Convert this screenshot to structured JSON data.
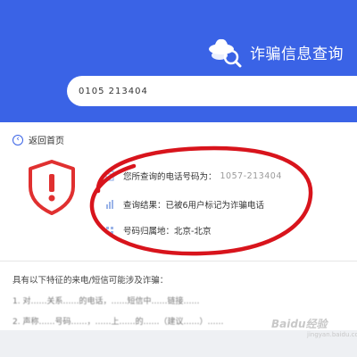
{
  "header": {
    "title": "诈骗信息查询",
    "search_value": "0105 213404"
  },
  "nav": {
    "back_label": "返回首页"
  },
  "result": {
    "phone_label": "您所查询的电话号码为：",
    "phone_value": "1057-213404",
    "result_label": "查询结果：",
    "result_value": "已被6用户标记为诈骗电话",
    "location_label": "号码归属地：",
    "location_value": "北京-北京"
  },
  "features": {
    "title": "具有以下特征的来电/短信可能涉及诈骗：",
    "items": [
      "1. 对……关系……的电话，……短信中……链接……",
      "2. 声称……号码……，……上……的……（建议……）……"
    ]
  },
  "watermark": {
    "text": "Baidu经验",
    "sub": "jingyan.baidu.com"
  },
  "colors": {
    "brand_blue": "#3a63e6",
    "alert_red": "#e03030",
    "annotation_red": "#d8141c"
  }
}
